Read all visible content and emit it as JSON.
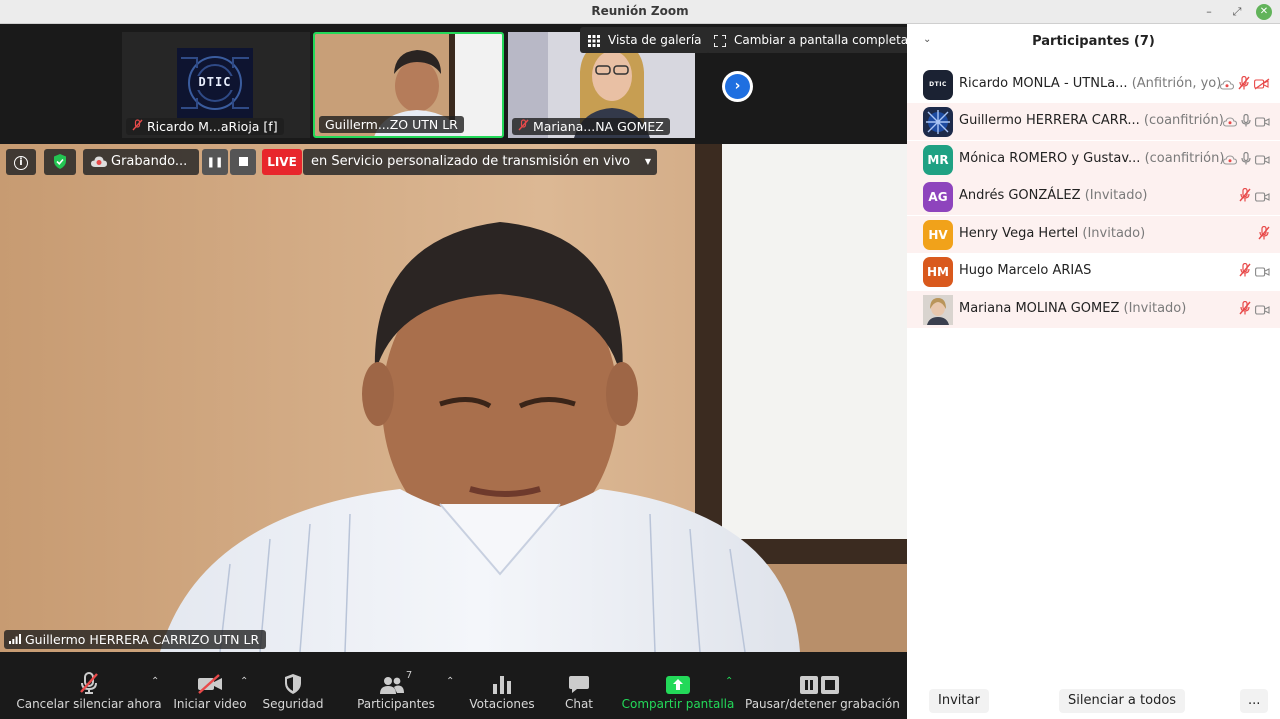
{
  "window": {
    "title": "Reunión Zoom",
    "minimize": "–",
    "restore": "⤢",
    "close": "✕"
  },
  "view": {
    "gallery_label": "Vista de galería",
    "fullscreen_label": "Cambiar a pantalla completa"
  },
  "thumbnails": [
    {
      "name": "Ricardo M...aRioja [f]",
      "logo_text": "DTIC",
      "muted": true,
      "active": false
    },
    {
      "name": "Guillerm...ZO UTN LR",
      "muted": false,
      "active": true
    },
    {
      "name": "Mariana...NA GOMEZ",
      "muted": true,
      "active": false
    }
  ],
  "recording": {
    "status": "Grabando...",
    "live_badge": "LIVE",
    "live_text": "en Servicio personalizado de transmisión en vivo"
  },
  "main_video": {
    "speaker": "Guillermo HERRERA CARRIZO UTN LR"
  },
  "toolbar": {
    "mute": "Cancelar silenciar ahora",
    "video": "Iniciar video",
    "security": "Seguridad",
    "participants": "Participantes",
    "participants_count": "7",
    "polls": "Votaciones",
    "chat": "Chat",
    "share": "Compartir pantalla",
    "record": "Pausar/detener grabación"
  },
  "panel": {
    "title": "Participantes (7)",
    "collapse": "⌄",
    "participants": [
      {
        "initials": "DTIC",
        "name": "Ricardo MONLA - UTNLa...",
        "role": "(Anfitrión, yo)",
        "color": "#1b2233",
        "mic": "muted",
        "video": "off",
        "highlight": false
      },
      {
        "initials": "",
        "name": "Guillermo HERRERA CARR...",
        "role": "(coanfitrión)",
        "color": "#1d2a4a",
        "mic": "on",
        "video": "on",
        "highlight": true
      },
      {
        "initials": "MR",
        "name": "Mónica ROMERO y Gustav...",
        "role": "(coanfitrión)",
        "color": "#1fa183",
        "mic": "on",
        "video": "on",
        "highlight": true
      },
      {
        "initials": "AG",
        "name": "Andrés GONZÁLEZ",
        "role": "(Invitado)",
        "color": "#8e44bd",
        "mic": "muted",
        "video": "on",
        "highlight": true
      },
      {
        "initials": "HV",
        "name": "Henry Vega Hertel",
        "role": "(Invitado)",
        "color": "#f1a21a",
        "mic": "muted",
        "video": "none",
        "highlight": true
      },
      {
        "initials": "HM",
        "name": "Hugo Marcelo ARIAS",
        "role": "",
        "color": "#d9591d",
        "mic": "muted",
        "video": "on",
        "highlight": false
      },
      {
        "initials": "",
        "name": "Mariana MOLINA GOMEZ",
        "role": "(Invitado)",
        "color": "#c9b8a6",
        "mic": "muted",
        "video": "on",
        "highlight": true
      }
    ],
    "invite": "Invitar",
    "mute_all": "Silenciar a todos",
    "more": "..."
  }
}
